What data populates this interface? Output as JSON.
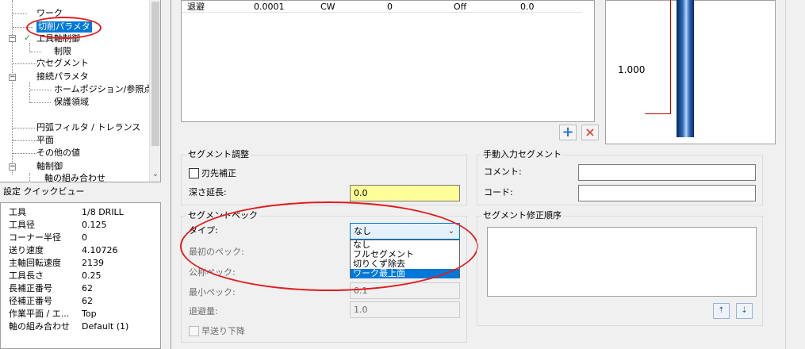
{
  "tree": {
    "items": [
      {
        "label": "ワーク"
      },
      {
        "label": "切削パラメタ"
      },
      {
        "label": "工具軸制御"
      },
      {
        "label": "制限"
      },
      {
        "label": "穴セグメント"
      },
      {
        "label": "接続パラメタ"
      },
      {
        "label": "ホームポジション/参照点"
      },
      {
        "label": "保護領域"
      },
      {
        "label": "円弧フィルタ / トレランス"
      },
      {
        "label": "平面"
      },
      {
        "label": "その他の値"
      },
      {
        "label": "軸制御"
      },
      {
        "label": "軸の組み合わせ"
      }
    ],
    "expander_symbol": "−",
    "check_symbol": "✓",
    "scroll_down": "⌄"
  },
  "quick_view": {
    "title": "設定 クイックビュー",
    "rows": [
      {
        "label": "工具",
        "value": "1/8 DRILL"
      },
      {
        "label": "工具径",
        "value": "0.125"
      },
      {
        "label": "コーナー半径",
        "value": "0"
      },
      {
        "label": "送り速度",
        "value": "4.10726"
      },
      {
        "label": "主軸回転速度",
        "value": "2139"
      },
      {
        "label": "工具長さ",
        "value": "0.25"
      },
      {
        "label": "長補正番号",
        "value": "62"
      },
      {
        "label": "径補正番号",
        "value": "62"
      },
      {
        "label": "作業平面 / エ...",
        "value": "Top"
      },
      {
        "label": "軸の組み合わせ",
        "value": "Default (1)"
      }
    ]
  },
  "table": {
    "row": [
      "退避",
      "0.0001",
      "CW",
      "0",
      "Off",
      "0.0"
    ]
  },
  "table_buttons": {
    "add": "+",
    "delete": "×"
  },
  "preview": {
    "dimension": "1.000"
  },
  "segment_adjust": {
    "title": "セグメント調整",
    "tip_comp": "刃先補正",
    "depth_ext_label": "深さ延長:",
    "depth_ext_value": "0.0"
  },
  "manual_segment": {
    "title": "手動入力セグメント",
    "comment_label": "コメント:",
    "comment_value": "",
    "code_label": "コード:",
    "code_value": ""
  },
  "segment_peck": {
    "title": "セグメントペック",
    "type_label": "タイプ:",
    "type_value": "なし",
    "combo_arrow": "⌄",
    "options": [
      "なし",
      "フルセグメント",
      "切りくず除去",
      "ワーク最上面"
    ],
    "first_peck_label": "最初のペック:",
    "nominal_peck_label": "公称ペック:",
    "min_peck_label": "最小ペック:",
    "min_peck_value": "0.1",
    "retract_label": "退避量:",
    "retract_value": "1.0",
    "rapid_down_label": "早送り下降"
  },
  "segment_order": {
    "title": "セグメント修正順序",
    "up_icon": "⇡",
    "down_icon": "⇣"
  },
  "colors": {
    "selection": "#0078d7",
    "highlight_ellipse": "#e41b1b",
    "yellow_field": "#ffff99",
    "tool_blue": "#2c67b5",
    "dimension_red": "#c00000",
    "delete_red": "#d9534f",
    "add_blue": "#2b7bd3"
  }
}
